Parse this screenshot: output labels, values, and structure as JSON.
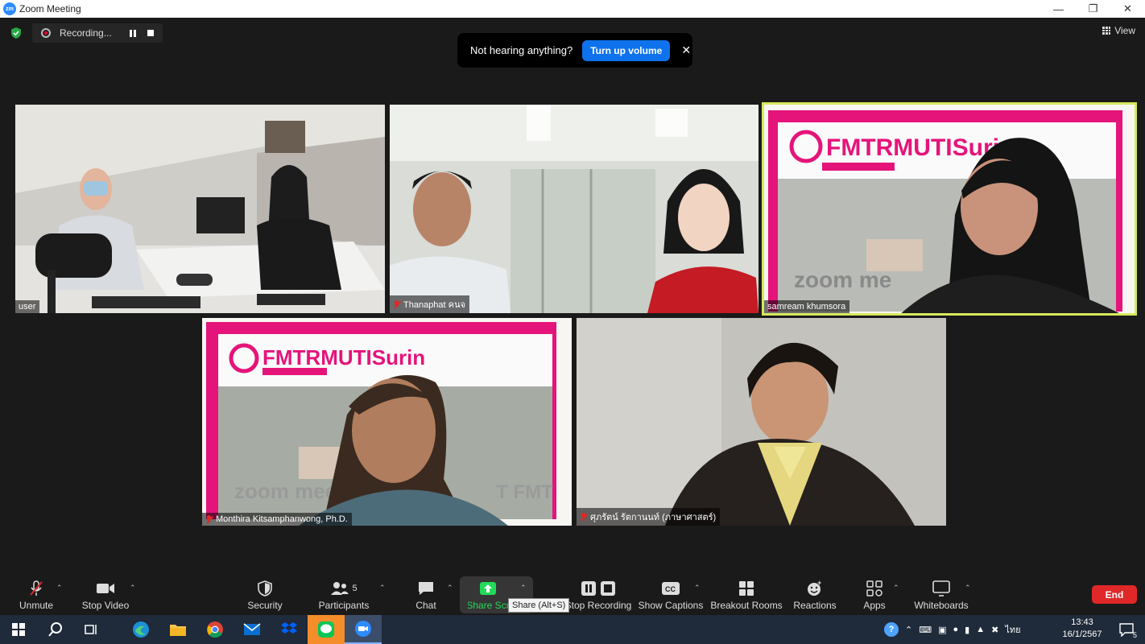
{
  "window": {
    "title": "Zoom Meeting",
    "logo": "zm",
    "controls": [
      "minimize-icon",
      "restore-icon",
      "close-icon"
    ]
  },
  "meeting_top": {
    "recording_text": "Recording...",
    "view_label": "View"
  },
  "notification": {
    "message": "Not hearing anything?",
    "action_label": "Turn up volume"
  },
  "participants": [
    {
      "name": "user",
      "muted": false,
      "active_speaker": false
    },
    {
      "name": "Thanaphat คนจ",
      "muted": true,
      "active_speaker": false
    },
    {
      "name": "samream khumsora",
      "muted": false,
      "active_speaker": true
    },
    {
      "name": "Monthira Kitsamphanwong, Ph.D.",
      "muted": true,
      "active_speaker": false
    },
    {
      "name": "ศุภรัตน์ รัตกานนท์ (ภาษาศาสตร์)",
      "muted": true,
      "active_speaker": false
    }
  ],
  "slide_text": {
    "brand": "FMTRMUTISurin",
    "watermark": "zoom me",
    "watermark2": "zoom mee",
    "suffix": "T FMT"
  },
  "toolbar": {
    "unmute": "Unmute",
    "stop_video": "Stop Video",
    "security": "Security",
    "participants": "Participants",
    "participants_count": "5",
    "chat": "Chat",
    "share_screen": "Share Scr",
    "stop_recording": "Stop Recording",
    "show_captions": "Show Captions",
    "breakout_rooms": "Breakout Rooms",
    "reactions": "Reactions",
    "apps": "Apps",
    "whiteboards": "Whiteboards",
    "end": "End",
    "share_tooltip": "Share (Alt+S)"
  },
  "taskbar": {
    "time": "13:43",
    "date": "16/1/2567",
    "language": "ไทย",
    "notification_count": "5"
  },
  "colors": {
    "accent_blue": "#0e72ed",
    "end_red": "#e02828",
    "active_border": "#d7e85c",
    "brand_pink": "#e5147a"
  }
}
